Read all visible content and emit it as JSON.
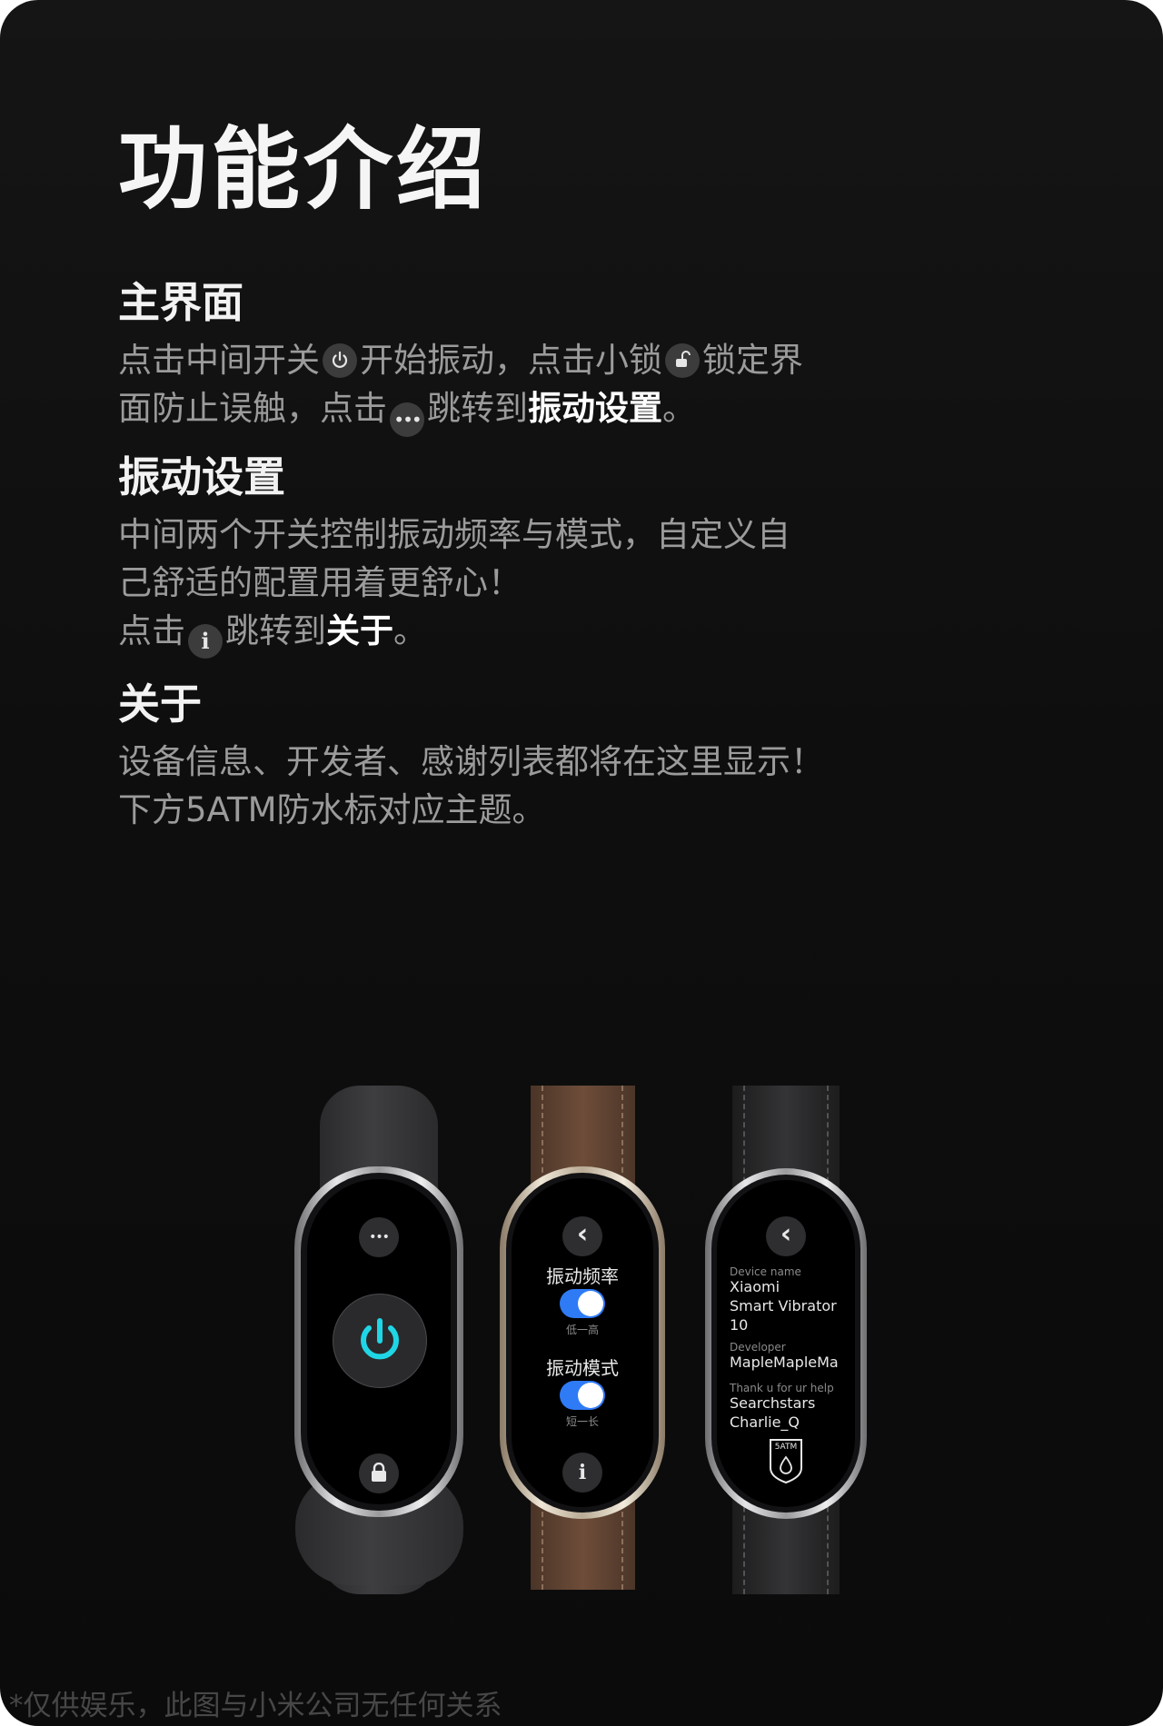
{
  "page": {
    "title": "功能介绍",
    "footer": "*仅供娱乐，此图与小米公司无任何关系"
  },
  "sections": {
    "main": {
      "title": "主界面",
      "line1_a": "点击中间开关",
      "line1_b": "开始振动，点击小锁",
      "line1_c": "锁定界",
      "line2_a": "面防止误触，点击",
      "line2_b": "跳转到",
      "line2_hl": "振动设置",
      "line2_end": "。"
    },
    "vibration": {
      "title": "振动设置",
      "line1": "中间两个开关控制振动频率与模式，自定义自",
      "line2": "己舒适的配置用着更舒心！",
      "line3_a": "点击",
      "line3_b": "跳转到",
      "line3_hl": "关于",
      "line3_end": "。"
    },
    "about": {
      "title": "关于",
      "line1": "设备信息、开发者、感谢列表都将在这里显示！",
      "line2": "下方5ATM防水标对应主题。"
    }
  },
  "icons": {
    "power": "power-icon",
    "lock": "lock-icon",
    "more": "more-dots-icon",
    "info": "info-icon",
    "back": "chevron-left-icon",
    "water": "water-drop-icon",
    "accent_power": "#1fd6e6",
    "toggle_on": "#2f7bf6"
  },
  "watch_main": {
    "more": "•••",
    "lock": "🔒"
  },
  "watch_settings": {
    "back": "‹",
    "freq_label": "振动频率",
    "freq_range": "低一高",
    "mode_label": "振动模式",
    "mode_range": "短一长",
    "info": "i"
  },
  "watch_about": {
    "back": "‹",
    "device_label": "Device name",
    "device_line1": "Xiaomi",
    "device_line2": "Smart Vibrator",
    "device_line3": "10",
    "dev_label": "Developer",
    "dev_value": "MapleMapleMa",
    "thanks_label": "Thank u for ur help",
    "thanks_1": "Searchstars",
    "thanks_2": "Charlie_Q",
    "badge": "5ATM"
  }
}
